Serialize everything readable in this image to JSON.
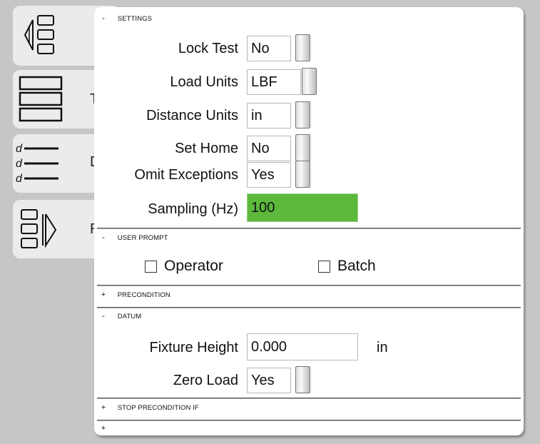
{
  "tabs": [
    {
      "icon": "layout-left-arrow-icon",
      "peek": ""
    },
    {
      "icon": "three-boxes-icon",
      "peek": "T"
    },
    {
      "icon": "distance-list-icon",
      "peek": "D",
      "glyph": "d"
    },
    {
      "icon": "layout-right-arrow-icon",
      "peek": "R"
    }
  ],
  "settings": {
    "title": "SETTINGS",
    "toggle": "-",
    "fields": [
      {
        "label": "Lock Test",
        "value": "No"
      },
      {
        "label": "Load Units",
        "value": "LBF"
      },
      {
        "label": "Distance Units",
        "value": "in"
      },
      {
        "label": "Set Home",
        "value": "No"
      },
      {
        "label": "Omit Exceptions",
        "value": "Yes"
      },
      {
        "label": "Sampling (Hz)",
        "value": "100"
      }
    ]
  },
  "user_prompt": {
    "title": "USER PROMPT",
    "toggle": "-",
    "options": [
      {
        "label": "Operator",
        "checked": false
      },
      {
        "label": "Batch",
        "checked": false
      }
    ]
  },
  "precondition": {
    "title": "PRECONDITION",
    "toggle": "+"
  },
  "datum": {
    "title": "DATUM",
    "toggle": "-",
    "fixture_height": {
      "label": "Fixture Height",
      "value": "0.000",
      "unit": "in"
    },
    "zero_load": {
      "label": "Zero Load",
      "value": "Yes"
    }
  },
  "stop_precondition": {
    "title": "STOP PRECONDITION IF",
    "toggle": "+"
  },
  "last_section": {
    "toggle": "+"
  },
  "colors": {
    "active_field": "#5cb93c",
    "background": "#c6c6c6",
    "panel": "#ffffff"
  }
}
